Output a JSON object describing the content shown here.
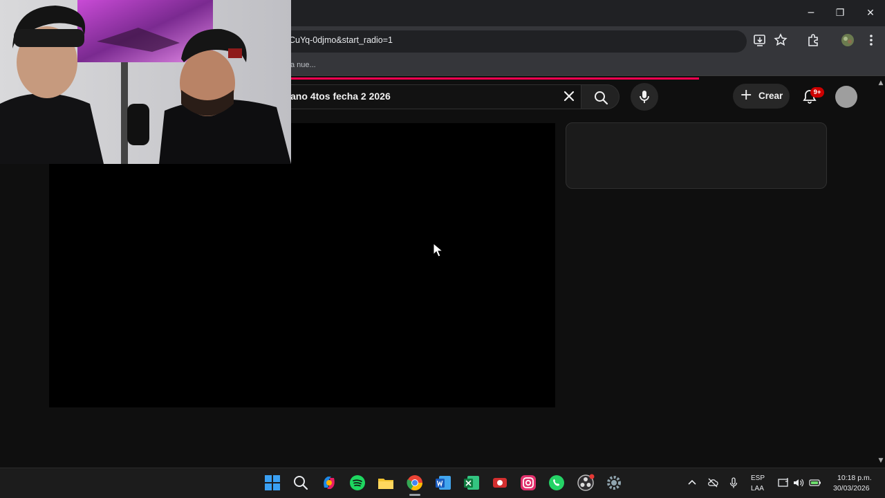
{
  "browser": {
    "window_controls": {
      "minimize": "─",
      "restore": "❐",
      "close": "✕"
    },
    "address_bar": {
      "url": "CuYq-0djmo&start_radio=1"
    },
    "bookmarks_bar": {
      "visible_item": "a nue..."
    },
    "loading_progress": 0.79,
    "toolbar_icons": [
      "install-app-icon",
      "star-icon",
      "extensions-icon",
      "profile-icon",
      "kebab-menu-icon"
    ]
  },
  "youtube": {
    "search": {
      "query": "ano 4tos fecha 2 2026",
      "clear_icon": "close-icon",
      "search_icon": "search-icon",
      "mic_icon": "mic-icon"
    },
    "create_button": {
      "icon": "+",
      "label": "Crear"
    },
    "notifications": {
      "badge": "9+"
    },
    "colors": {
      "progress": "#ff0050",
      "badge": "#cc0000",
      "background": "#0f0f0f"
    }
  },
  "taskbar": {
    "apps": [
      "windows-start-icon",
      "search-icon",
      "copilot-icon",
      "spotify-icon",
      "file-explorer-icon",
      "chrome-icon",
      "word-icon",
      "excel-icon",
      "red-app-icon",
      "instagram-icon",
      "whatsapp-icon",
      "obs-icon",
      "settings-icon"
    ],
    "tray": {
      "language": {
        "code": "ESP",
        "layout": "LAA"
      },
      "clock": {
        "time": "10:18 p.m.",
        "date": "30/03/2026"
      }
    }
  }
}
